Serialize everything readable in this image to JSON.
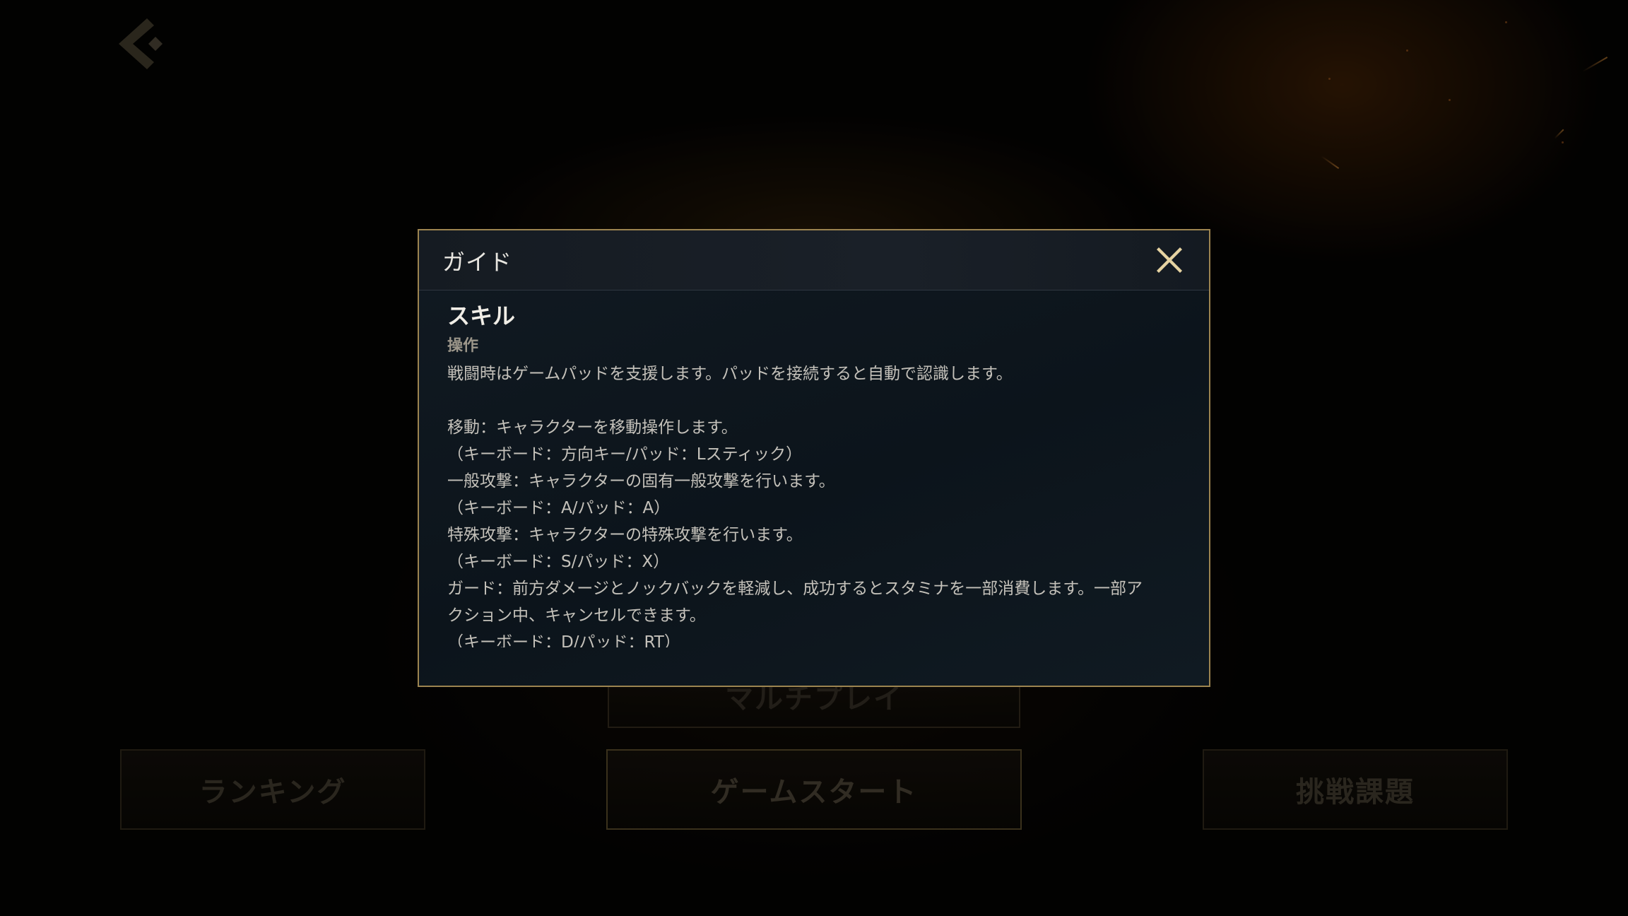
{
  "menu": {
    "ranking_label": "ランキング",
    "game_start_label": "ゲームスタート",
    "challenge_label": "挑戦課題",
    "multiplay_label": "マルチプレイ"
  },
  "guide": {
    "title": "ガイド",
    "section_title": "スキル",
    "subsection_title": "操作",
    "lines": [
      "戦闘時はゲームパッドを支援します。パッドを接続すると自動で認識します。",
      "",
      "移動：キャラクターを移動操作します。",
      "（キーボード：方向キー/パッド：Lスティック）",
      "一般攻撃：キャラクターの固有一般攻撃を行います。",
      "（キーボード：A/パッド：A）",
      "特殊攻撃：キャラクターの特殊攻撃を行います。",
      "（キーボード：S/パッド：X）",
      "ガード：前方ダメージとノックバックを軽減し、成功するとスタミナを一部消費します。一部ア",
      "クション中、キャンセルできます。",
      "（キーボード：D/パッド：RT）"
    ]
  },
  "colors": {
    "modal_border": "#9c8450",
    "close_icon": "#e6d3a2",
    "back_icon": "#4e4634"
  },
  "icons": {
    "back": "chevron-left-icon",
    "close": "close-icon"
  }
}
